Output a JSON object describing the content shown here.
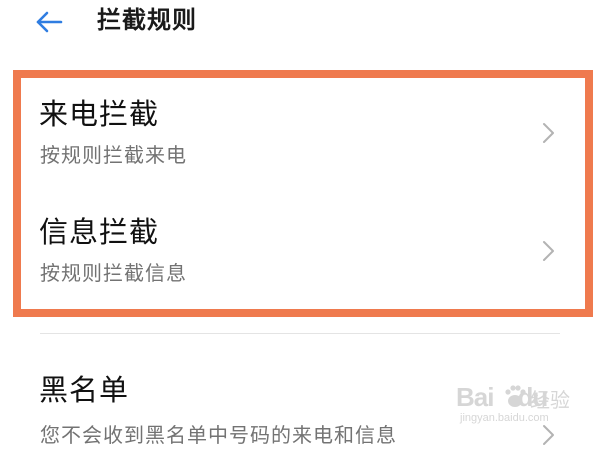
{
  "header": {
    "back_icon": "arrow-left-icon",
    "title": "拦截规则"
  },
  "highlight_color": "#ef7a4e",
  "accent_color": "#2f7de1",
  "rows": [
    {
      "title": "来电拦截",
      "subtitle": "按规则拦截来电",
      "icon": "chevron-right-icon"
    },
    {
      "title": "信息拦截",
      "subtitle": "按规则拦截信息",
      "icon": "chevron-right-icon"
    },
    {
      "title": "黑名单",
      "subtitle": "您不会收到黑名单中号码的来电和信息",
      "icon": "chevron-right-icon"
    }
  ],
  "watermark": {
    "brand": "Bai",
    "brand_suffix": "du",
    "jingyan": "经验",
    "url": "jingyan.baidu.com"
  }
}
